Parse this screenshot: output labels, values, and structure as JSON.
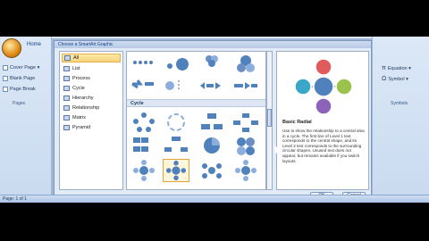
{
  "window": {
    "dialog_title": "Choose a SmartArt Graphic"
  },
  "ribbon": {
    "home_tab": "Home",
    "items": [
      "Cover Page ▾",
      "Blank Page",
      "Page Break"
    ],
    "group_label": "Pages",
    "right_items": [
      "Equation ▾",
      "Symbol ▾"
    ],
    "right_group_label": "Symbols"
  },
  "status": {
    "page_info": "Page: 1 of 1"
  },
  "categories": [
    {
      "label": "All",
      "selected": true
    },
    {
      "label": "List",
      "selected": false
    },
    {
      "label": "Process",
      "selected": false
    },
    {
      "label": "Cycle",
      "selected": false
    },
    {
      "label": "Hierarchy",
      "selected": false
    },
    {
      "label": "Relationship",
      "selected": false
    },
    {
      "label": "Matrix",
      "selected": false
    },
    {
      "label": "Pyramid",
      "selected": false
    }
  ],
  "gallery": {
    "section_label": "Cycle"
  },
  "preview": {
    "title": "Basic Radial",
    "description": "Use to show the relationship to a central idea in a cycle. The first line of Level 1 text corresponds to the central shape, and its Level 2 text corresponds to the surrounding circular shapes. Unused text does not appear, but remains available if you switch layouts."
  },
  "buttons": {
    "ok": "OK",
    "cancel": "Cancel"
  },
  "colors": {
    "accent": "#4f81bd",
    "selection": "#f8d37b"
  }
}
